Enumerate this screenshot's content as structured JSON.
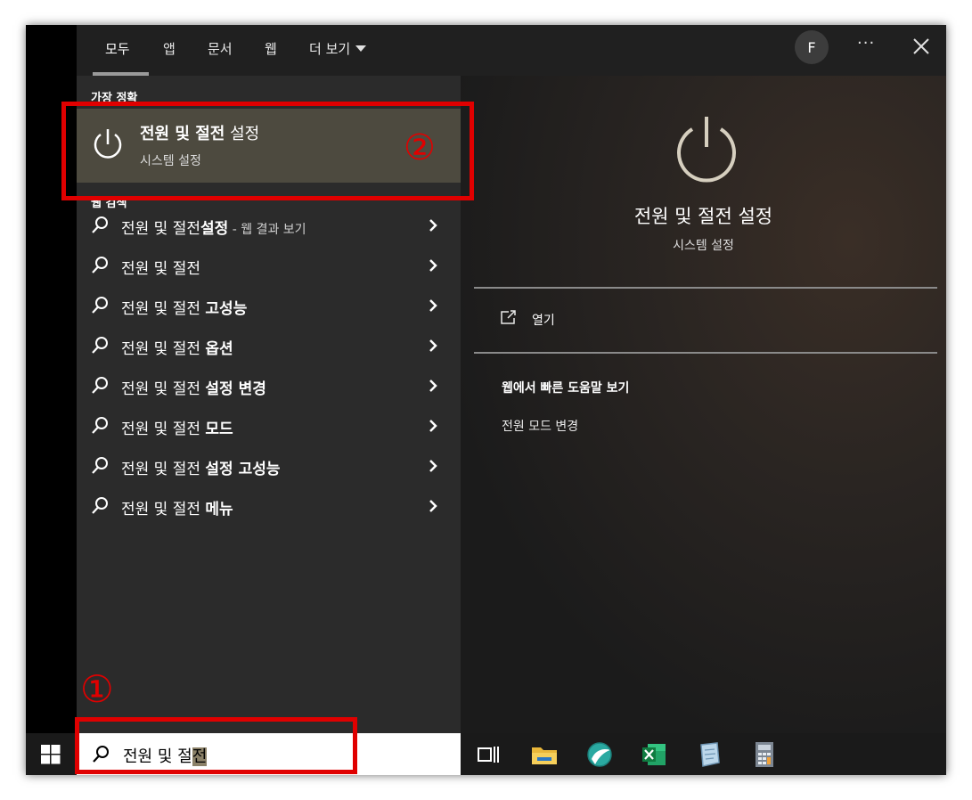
{
  "tabs": {
    "all": "모두",
    "apps": "앱",
    "documents": "문서",
    "web": "웹",
    "more": "더 보기"
  },
  "account_initial": "F",
  "more_options": "···",
  "best_match": {
    "header": "가장 정확",
    "title_bold": "전원 및 절전",
    "title_normal": " 설정",
    "subtitle": "시스템 설정"
  },
  "web_search": {
    "header": "웹 검색",
    "items": [
      {
        "plain": "전원 및 절전",
        "bold": "설정",
        "suffix": " - 웹 결과 보기"
      },
      {
        "plain": "전원 및 절전",
        "bold": "",
        "suffix": ""
      },
      {
        "plain": "전원 및 절전 ",
        "bold": "고성능",
        "suffix": ""
      },
      {
        "plain": "전원 및 절전 ",
        "bold": "옵션",
        "suffix": ""
      },
      {
        "plain": "전원 및 절전 ",
        "bold": "설정 변경",
        "suffix": ""
      },
      {
        "plain": "전원 및 절전 ",
        "bold": "모드",
        "suffix": ""
      },
      {
        "plain": "전원 및 절전 ",
        "bold": "설정 고성능",
        "suffix": ""
      },
      {
        "plain": "전원 및 절전 ",
        "bold": "메뉴",
        "suffix": ""
      }
    ]
  },
  "preview": {
    "title": "전원 및 절전 설정",
    "subtitle": "시스템 설정",
    "open_label": "열기",
    "web_help_header": "웹에서 빠른 도움말 보기",
    "web_help_link": "전원 모드 변경"
  },
  "search": {
    "typed": "전원 및 절",
    "highlighted": "전"
  },
  "annotations": {
    "marker_one": "①",
    "marker_two": "②"
  },
  "colors": {
    "annotation_red": "#e00000",
    "selected_card": "#4d4a3f",
    "panel_bg": "#2b2b2b"
  }
}
